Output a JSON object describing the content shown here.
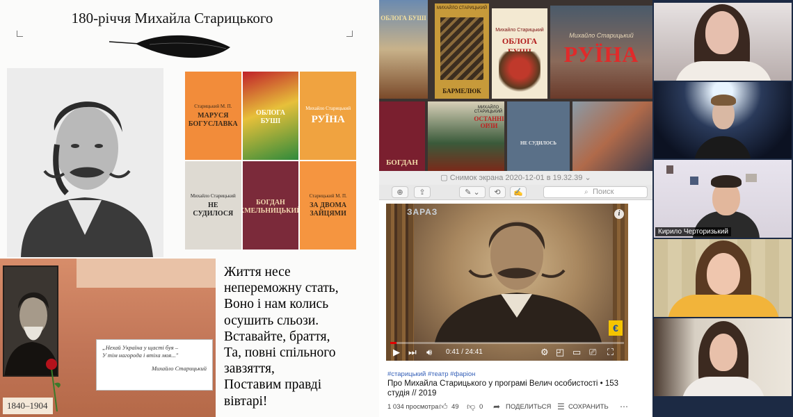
{
  "slide": {
    "title": "180-річчя Михайла Старицького",
    "books": [
      {
        "author": "Старицький М. П.",
        "title": "МАРУСЯ БОГУСЛАВКА"
      },
      {
        "author": "",
        "title": "ОБЛОГА БУШІ"
      },
      {
        "author": "Михайло Старицький",
        "title": "РУЇНА"
      },
      {
        "author": "Михайло Старицький",
        "title": "НЕ СУДИЛОСЯ"
      },
      {
        "author": "",
        "title": "БОГДАН ХМЕЛЬНИЦЬКИЙ"
      },
      {
        "author": "Старицький М. П.",
        "title": "ЗА ДВОМА ЗАЙЦЯМИ"
      }
    ],
    "plaque": {
      "quote_line1": "„Нехай Україна у щасті буя –",
      "quote_line2": "У тім нагорода і втіха моя...\"",
      "signature": "Михайло Старицький"
    },
    "years": "1840–1904",
    "poem": [
      "Життя несе",
      "непереможну стать,",
      "Воно і нам колись",
      "осушить сльози.",
      "Вставайте, браття,",
      "Та, повні спільного",
      "завзяття,",
      "Поставим правді",
      "вівтарі!"
    ]
  },
  "covers": {
    "c1": "ОБЛОГА БУШІ",
    "c2_author": "МИХАЙЛО СТАРИЦЬКИЙ",
    "c2_title": "БАРМЕЛЮК",
    "c3_author": "Михайло Старицький",
    "c3_title": "ОБЛОГА БУШІ",
    "c4_author": "Михайло Старицький",
    "c4_title": "РУЇНА",
    "c5_title": "БОГДАН",
    "c6_author": "МИХАЙЛО СТАРИЦЬКИЙ",
    "c6_title": "ОСТАННІ ОРЛИ",
    "c7_title": "НЕ СУДИЛОСЬ"
  },
  "preview": {
    "window_title": "Снимок экрана 2020-12-01 в 19.32.39",
    "search_placeholder": "Поиск"
  },
  "video": {
    "channel_logo": "ЗАРАЗ",
    "time": "0:41 / 24:41",
    "progress": 0.028,
    "tags": "#старицький #театр #фаріон",
    "title": "Про Михайла Старицького у програмі Велич особистості • 153 студія // 2019",
    "views": "1 034 просмотра",
    "likes": "49",
    "dislikes": "0",
    "share": "ПОДЕЛИТЬСЯ",
    "save": "СОХРАНИТЬ"
  },
  "participants": [
    {
      "name": ""
    },
    {
      "name": ""
    },
    {
      "name": "Кирило Черторизький"
    },
    {
      "name": ""
    },
    {
      "name": ""
    }
  ],
  "colors": {
    "active_speaker": "#b7e34a",
    "progress": "#e10000",
    "tag_link": "#3560b8",
    "zoom_bg": "#1c2a44"
  }
}
